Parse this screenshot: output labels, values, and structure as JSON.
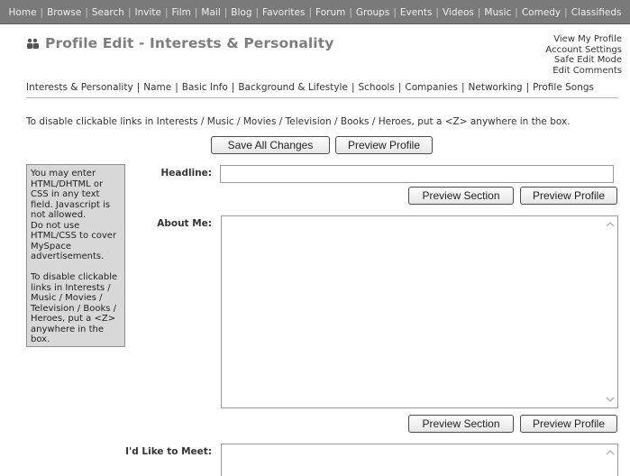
{
  "topnav": {
    "items": [
      "Home",
      "Browse",
      "Search",
      "Invite",
      "Film",
      "Mail",
      "Blog",
      "Favorites",
      "Forum",
      "Groups",
      "Events",
      "Videos",
      "Music",
      "Comedy",
      "Classifieds"
    ]
  },
  "header": {
    "title": "Profile Edit  - Interests & Personality",
    "title_icon": "users-icon",
    "account_links": [
      "View My Profile",
      "Account Settings",
      "Safe Edit Mode",
      "Edit Comments"
    ]
  },
  "subnav": {
    "items": [
      "Interests & Personality",
      "Name",
      "Basic Info",
      "Background & Lifestyle",
      "Schools",
      "Companies",
      "Networking",
      "Profile Songs"
    ]
  },
  "notice": "To disable clickable links in Interests / Music / Movies / Television / Books / Heroes, put a <Z> anywhere in the box.",
  "buttons": {
    "save_all": "Save All Changes",
    "preview_profile": "Preview Profile",
    "preview_section": "Preview Section"
  },
  "sidebox": {
    "text": "You may enter HTML/DHTML or CSS in any text field. Javascript is not allowed.\nDo not use HTML/CSS to cover MySpace advertisements.\n\nTo disable clickable links in Interests / Music / Movies / Television / Books / Heroes, put a <Z> anywhere in the box."
  },
  "fields": {
    "headline": {
      "label": "Headline:",
      "value": ""
    },
    "about_me": {
      "label": "About Me:",
      "value": ""
    },
    "like_to_meet": {
      "label": "I'd Like to Meet:",
      "value": ""
    }
  }
}
